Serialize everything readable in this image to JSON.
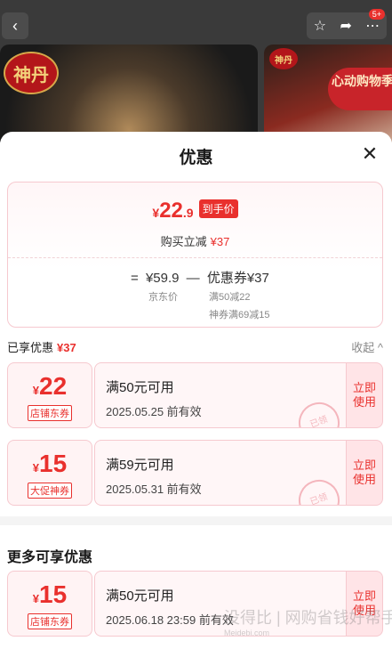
{
  "background": {
    "badge_count": "5+",
    "brand_text": "神丹",
    "brand_text_small": "神丹",
    "promo_text": "心动购物季"
  },
  "sheet": {
    "title": "优惠",
    "summary": {
      "yen": "¥",
      "price_int": "22",
      "price_dec": ".9",
      "final_tag": "到手价",
      "buy_label": "购买立减",
      "buy_amount": "¥37",
      "formula_eq": "=",
      "formula_price": "¥59.9",
      "formula_minus": "—",
      "formula_coupon": "优惠券¥37",
      "jd_price_label": "京东价",
      "coupon_detail_1": "满50减22",
      "coupon_detail_2": "神券满69减15"
    },
    "enjoyed": {
      "label": "已享优惠",
      "amount": "¥37",
      "collapse": "收起 ^"
    },
    "coupons": [
      {
        "yen": "¥",
        "amount": "22",
        "type": "店铺东券",
        "condition": "满50元可用",
        "expiry": "2025.05.25 前有效",
        "stamp": "已领",
        "action": "立即使用"
      },
      {
        "yen": "¥",
        "amount": "15",
        "type": "大促神券",
        "condition": "满59元可用",
        "expiry": "2025.05.31 前有效",
        "stamp": "已领",
        "action": "立即使用"
      }
    ],
    "more_title": "更多可享优惠",
    "more_coupons": [
      {
        "yen": "¥",
        "amount": "15",
        "type": "店铺东券",
        "condition": "满50元可用",
        "expiry": "2025.06.18 23:59 前有效",
        "action": "立即使用"
      }
    ],
    "watermark": "没得比 | 网购省钱好帮手",
    "watermark_url": "Meidebi.com"
  },
  "colors": {
    "accent": "#e9302d",
    "border": "#f6c9cf",
    "bg_pink": "#fff6f7"
  }
}
